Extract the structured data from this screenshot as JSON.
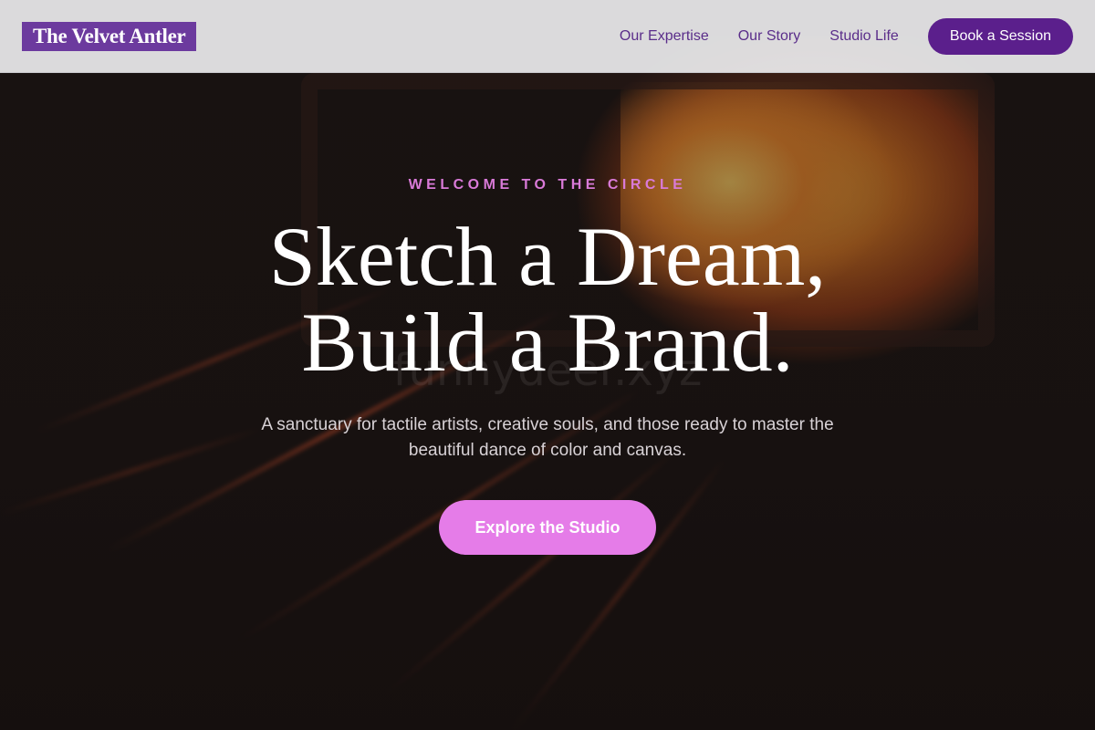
{
  "brand": {
    "name": "The Velvet Antler"
  },
  "nav": {
    "links": [
      "Our Expertise",
      "Our Story",
      "Studio Life"
    ],
    "cta_label": "Book a Session"
  },
  "hero": {
    "eyebrow": "WELCOME TO THE CIRCLE",
    "headline_line1": "Sketch a Dream,",
    "headline_line2": "Build a Brand.",
    "subtitle": "A sanctuary for tactile artists, creative souls, and those ready to master the beautiful dance of color and canvas.",
    "cta_label": "Explore the Studio",
    "watermark": "funnydeer.xyz"
  },
  "colors": {
    "accent": "#5b1f8c",
    "logo_bg": "#6c3a9e",
    "cta_pink": "#e57ce8",
    "eyebrow": "#d97ad8"
  }
}
